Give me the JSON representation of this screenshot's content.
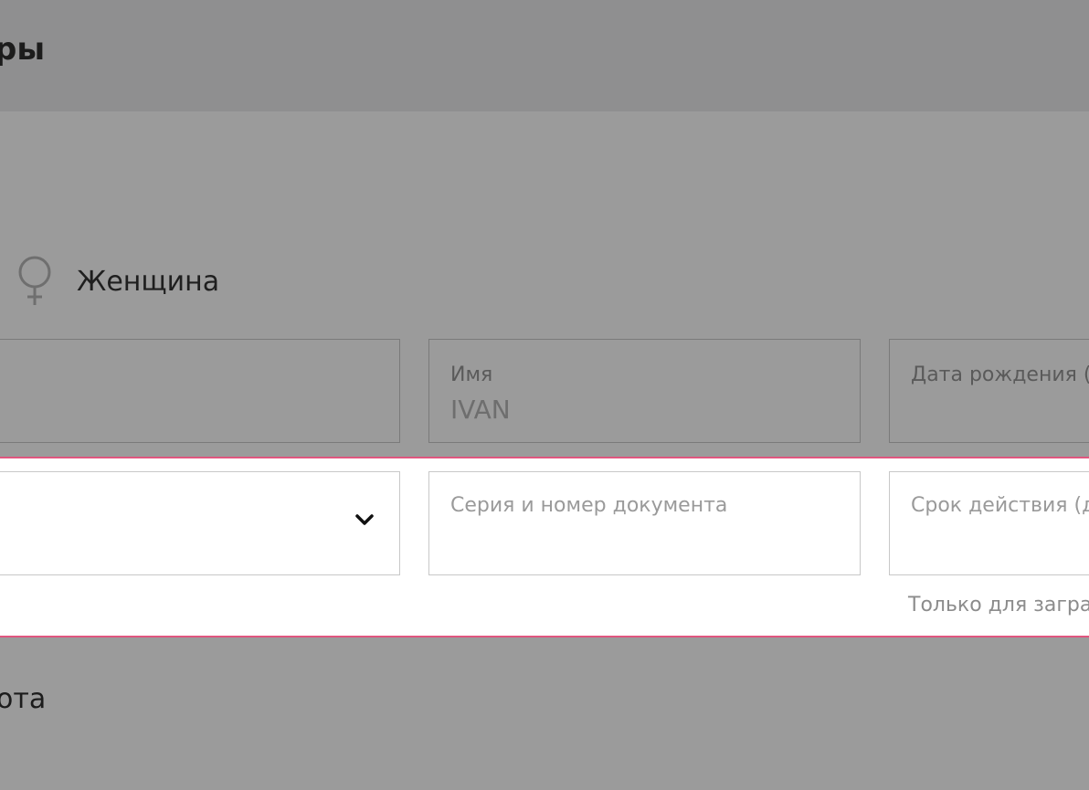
{
  "header": {
    "title": "ры"
  },
  "gender": {
    "female_label": "Женщина"
  },
  "fields": {
    "first_name": {
      "label": "Имя",
      "value": "IVAN"
    },
    "birth_date": {
      "label": "Дата рождения (д"
    }
  },
  "document": {
    "number_placeholder": "Серия и номер документа",
    "expiry_label": "Срок действия (д",
    "expiry_hint": "Только для загран"
  },
  "section": {
    "partial_label": "ота"
  },
  "colors": {
    "overlay": "#9b9b9b",
    "header": "#8f8f90",
    "accent_border": "#e0567f",
    "panel": "#ffffff"
  }
}
